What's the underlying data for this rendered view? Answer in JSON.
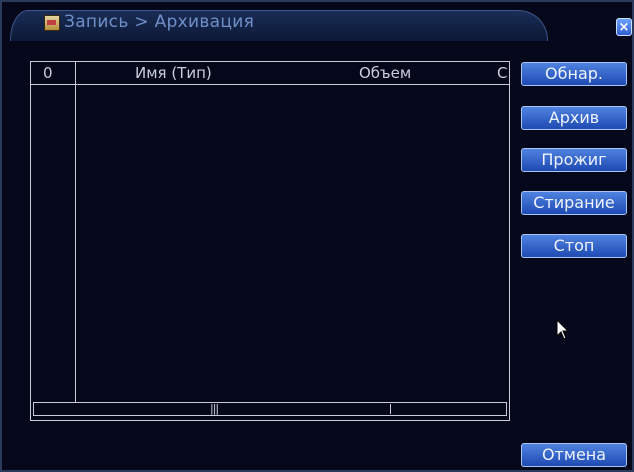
{
  "window": {
    "breadcrumb": "Запись > Архивация",
    "close_glyph": "×"
  },
  "table": {
    "columns": [
      "0",
      "Имя (Тип)",
      "Объем",
      "С"
    ],
    "rows": [],
    "scroll_grip": "|||"
  },
  "buttons": {
    "detect": "Обнар.",
    "backup": "Архив",
    "burn": "Прожиг",
    "erase": "Стирание",
    "stop": "Стоп",
    "cancel": "Отмена"
  },
  "icons": {
    "title_icon": "record-archive-icon",
    "close": "close-icon",
    "pointer": "mouse-pointer-icon"
  },
  "colors": {
    "window_bg": "#05081a",
    "button_gradient_top": "#4f82e0",
    "button_gradient_bottom": "#1e4ab2",
    "title_text": "#6f8fc7"
  }
}
